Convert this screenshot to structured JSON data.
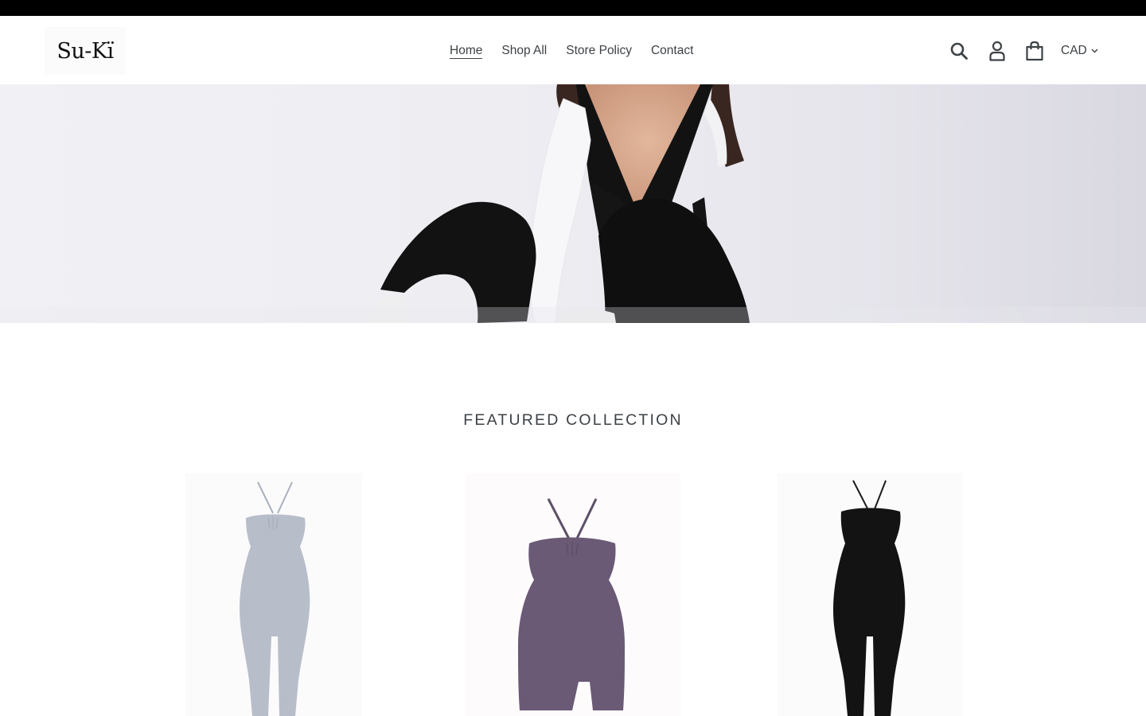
{
  "store": {
    "logo_text": "Su-Kï"
  },
  "nav": {
    "items": [
      {
        "label": "Home",
        "active": true
      },
      {
        "label": "Shop All",
        "active": false
      },
      {
        "label": "Store Policy",
        "active": false
      },
      {
        "label": "Contact",
        "active": false
      }
    ]
  },
  "header": {
    "icons": [
      "search-icon",
      "account-icon",
      "cart-icon"
    ],
    "currency": "CAD"
  },
  "featured": {
    "title": "FEATURED COLLECTION",
    "products": [
      {
        "color_name": "light-gray",
        "color": "#b8bdca"
      },
      {
        "color_name": "purple",
        "color": "#6a5a76"
      },
      {
        "color_name": "black",
        "color": "#131313"
      }
    ]
  },
  "colors": {
    "announcement_bar": "#000000",
    "text": "#3d4246"
  }
}
